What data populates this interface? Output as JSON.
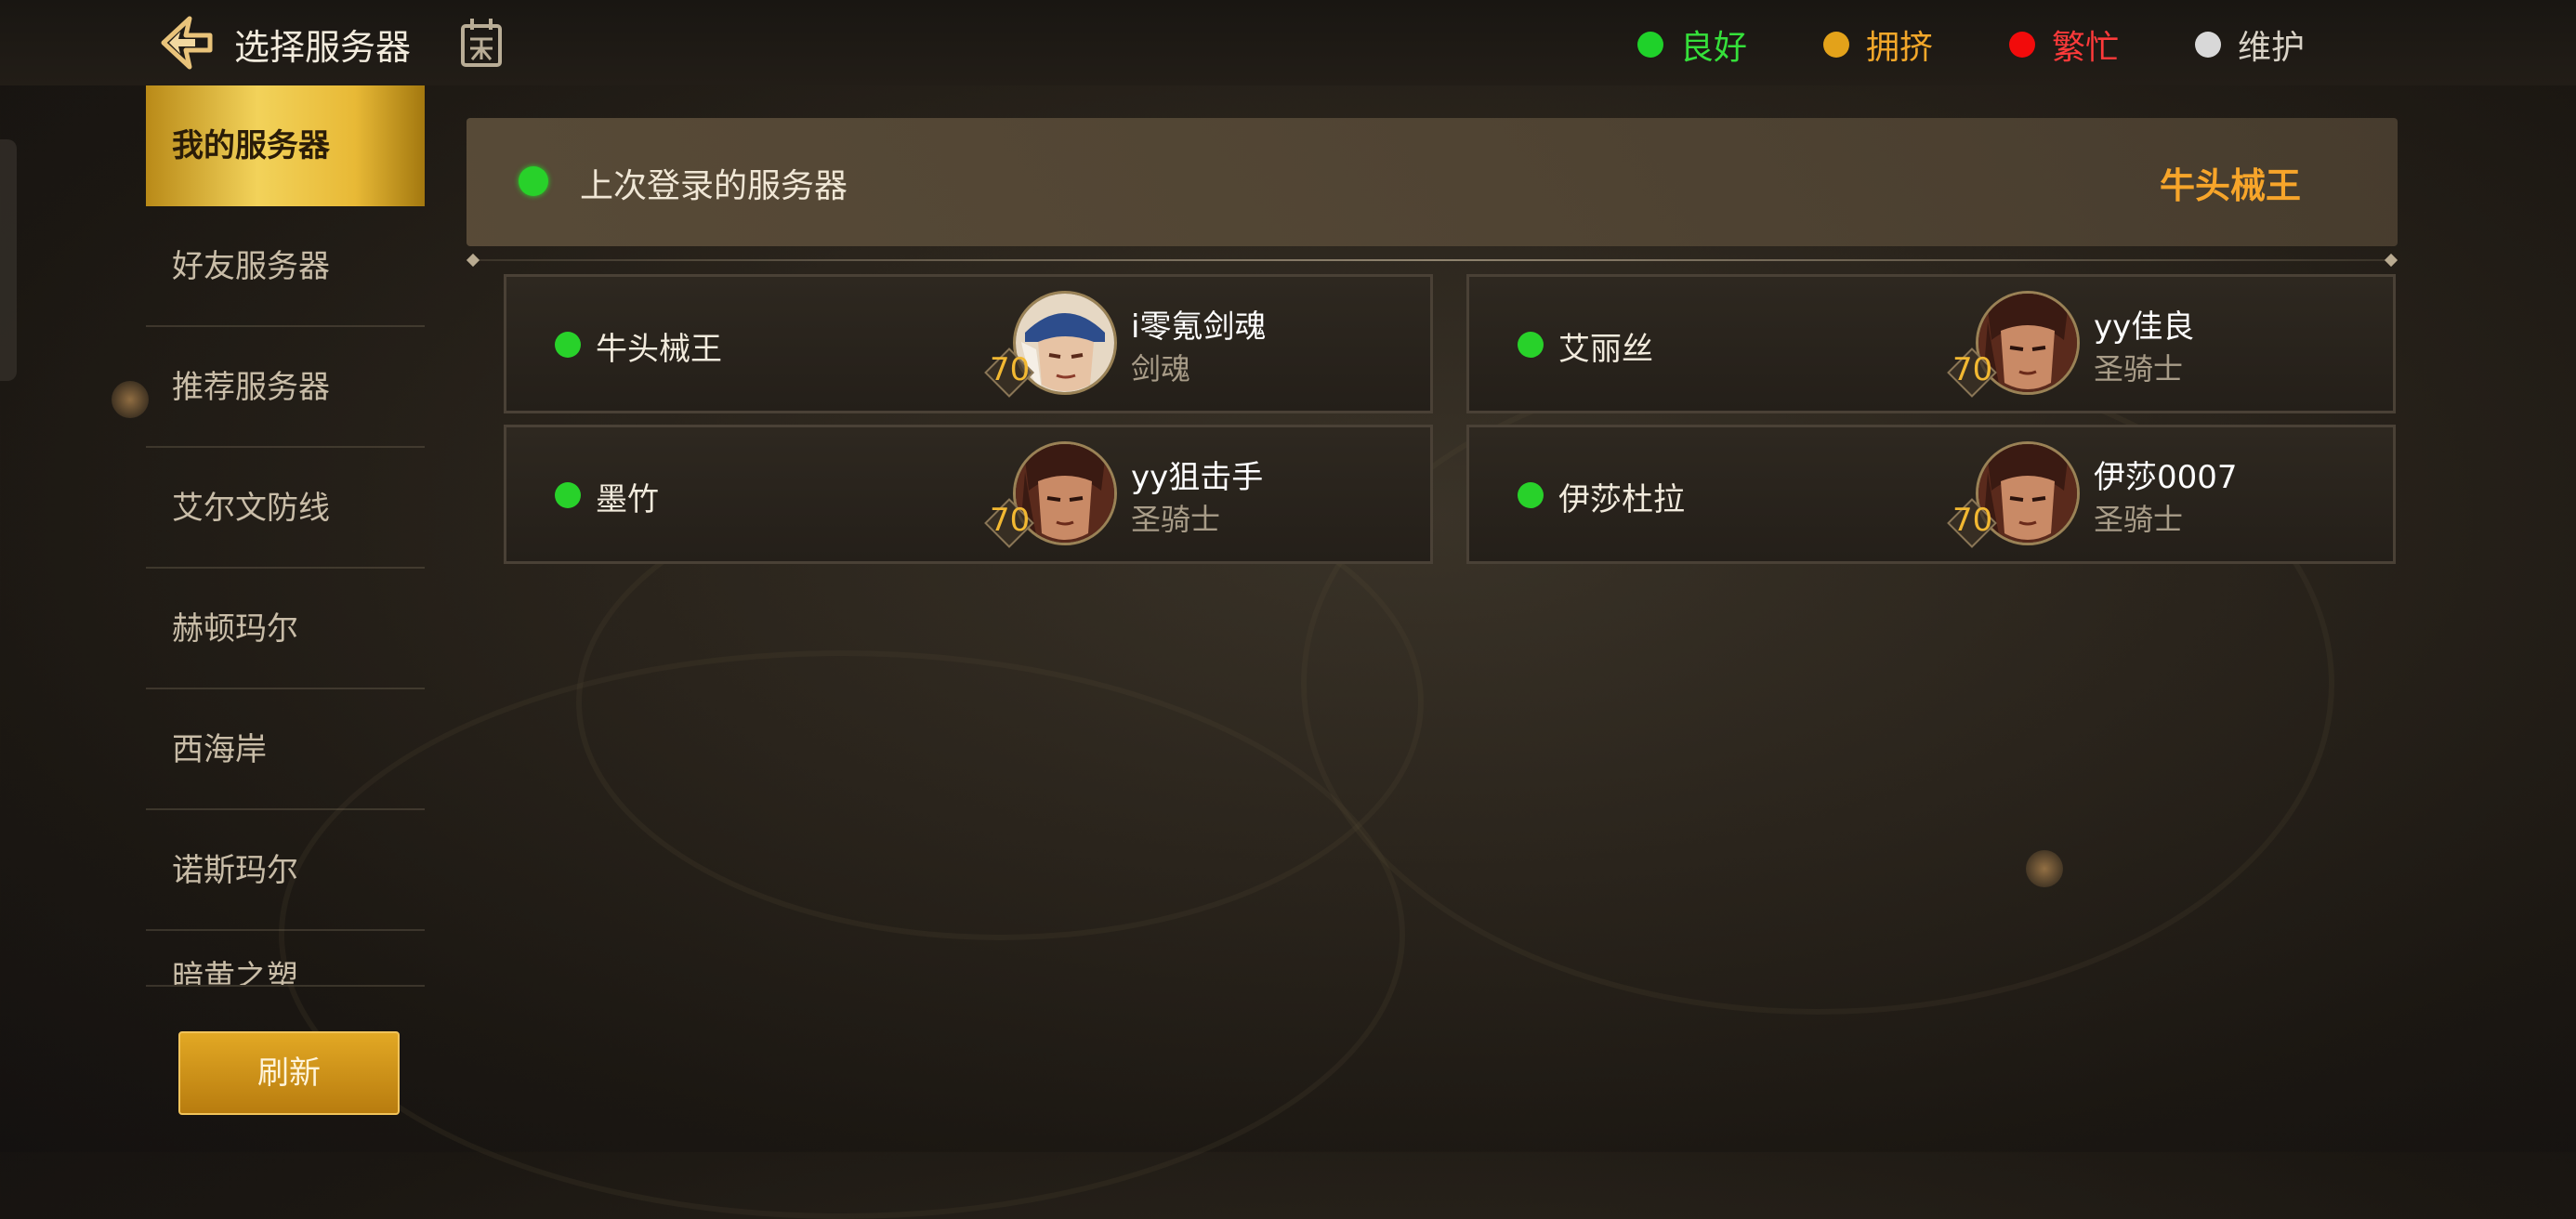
{
  "header": {
    "title": "选择服务器"
  },
  "status_legend": [
    {
      "label": "良好",
      "color": "#1fd12a",
      "text_color": "#35e03a"
    },
    {
      "label": "拥挤",
      "color": "#e3a21a",
      "text_color": "#f2a72a"
    },
    {
      "label": "繁忙",
      "color": "#f20b0b",
      "text_color": "#ff3a3a"
    },
    {
      "label": "维护",
      "color": "#d8d8d8",
      "text_color": "#d8d2c6"
    }
  ],
  "sidebar": {
    "items": [
      {
        "label": "我的服务器"
      },
      {
        "label": "好友服务器"
      },
      {
        "label": "推荐服务器"
      },
      {
        "label": "艾尔文防线"
      },
      {
        "label": "赫顿玛尔"
      },
      {
        "label": "西海岸"
      },
      {
        "label": "诺斯玛尔"
      },
      {
        "label": "暗黄之塑"
      }
    ],
    "refresh_label": "刷新"
  },
  "last_login": {
    "label": "上次登录的服务器",
    "server_name": "牛头械王"
  },
  "servers": [
    {
      "server": "牛头械王",
      "char_name": "i零氪剑魂",
      "char_class": "剑魂",
      "level": "70"
    },
    {
      "server": "艾丽丝",
      "char_name": "yy佳良",
      "char_class": "圣骑士",
      "level": "70"
    },
    {
      "server": "墨竹",
      "char_name": "yy狙击手",
      "char_class": "圣骑士",
      "level": "70"
    },
    {
      "server": "伊莎杜拉",
      "char_name": "伊莎0007",
      "char_class": "圣骑士",
      "level": "70"
    }
  ],
  "colors": {
    "accent_gold": "#e8b936",
    "status_good": "#28d12a",
    "last_server_orange": "#f7a52a"
  }
}
